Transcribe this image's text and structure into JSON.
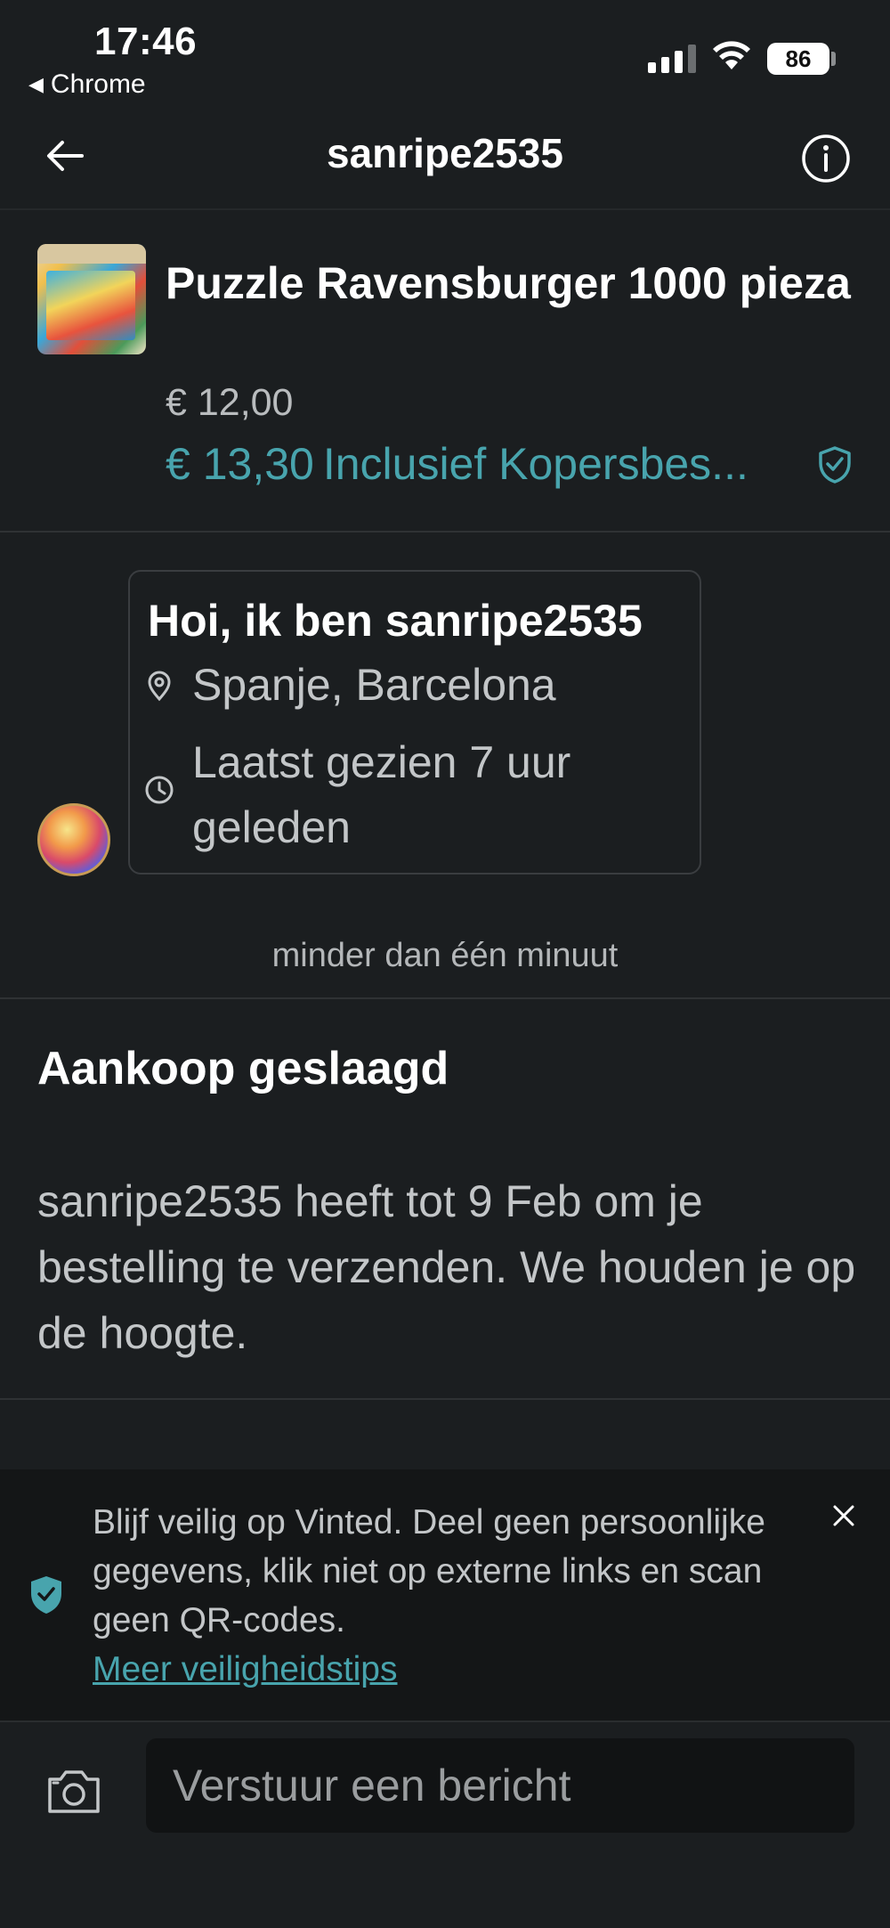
{
  "status_bar": {
    "time": "17:46",
    "back_app": "Chrome",
    "battery": "86"
  },
  "header": {
    "title": "sanripe2535"
  },
  "item": {
    "title": "Puzzle Ravensburger 1000 pieza",
    "price": "€ 12,00",
    "price_incl": "€ 13,30",
    "incl_label": "Inclusief Kopersbes..."
  },
  "intro": {
    "greeting": "Hoi, ik ben sanripe2535",
    "location": "Spanje, Barcelona",
    "last_seen": "Laatst gezien 7 uur geleden"
  },
  "timestamp": "minder dan één minuut",
  "status": {
    "title": "Aankoop geslaagd",
    "body": "sanripe2535 heeft tot 9 Feb om je bestelling te verzenden. We houden je op de hoogte."
  },
  "safety_banner": {
    "text": "Blijf veilig op Vinted. Deel geen persoonlijke gegevens, klik niet op externe links en scan geen QR-codes.",
    "link": "Meer veiligheidstips"
  },
  "composer": {
    "placeholder": "Verstuur een bericht"
  },
  "colors": {
    "background": "#1b1e20",
    "accent": "#48a4ad",
    "banner_bg": "#141617"
  }
}
